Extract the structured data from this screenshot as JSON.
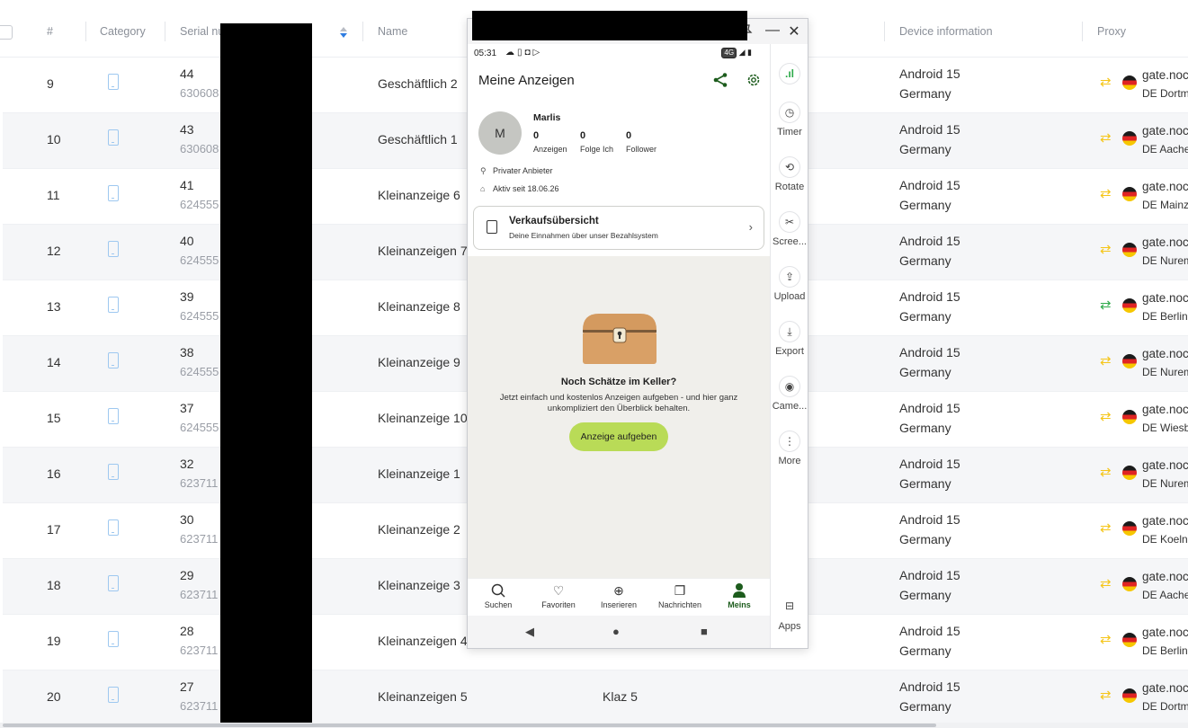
{
  "table": {
    "headers": {
      "idx": "#",
      "category": "Category",
      "serial": "Serial nu",
      "name": "Name",
      "device": "Device information",
      "proxy": "Proxy"
    },
    "rows": [
      {
        "idx": "9",
        "serial": "44",
        "serial2": "630608",
        "name": "Geschäftlich 2",
        "note": "",
        "os": "Android 15",
        "country": "Germany",
        "gate": "gate.noc",
        "loc": "DE Dortm",
        "swap_color": "#f5c518"
      },
      {
        "idx": "10",
        "serial": "43",
        "serial2": "630608",
        "name": "Geschäftlich 1",
        "note": "",
        "os": "Android 15",
        "country": "Germany",
        "gate": "gate.noc",
        "loc": "DE Aache",
        "swap_color": "#f5c518"
      },
      {
        "idx": "11",
        "serial": "41",
        "serial2": "624555",
        "name": "Kleinanzeige 6",
        "note": "",
        "os": "Android 15",
        "country": "Germany",
        "gate": "gate.noc",
        "loc": "DE Mainz",
        "swap_color": "#f5c518"
      },
      {
        "idx": "12",
        "serial": "40",
        "serial2": "624555",
        "name": "Kleinanzeigen 7",
        "note": "",
        "os": "Android 15",
        "country": "Germany",
        "gate": "gate.noc",
        "loc": "DE Nurem",
        "swap_color": "#f5c518"
      },
      {
        "idx": "13",
        "serial": "39",
        "serial2": "624555",
        "name": "Kleinanzeige 8",
        "note": "",
        "os": "Android 15",
        "country": "Germany",
        "gate": "gate.noc",
        "loc": "DE Berlin",
        "swap_color": "#2eaa4a"
      },
      {
        "idx": "14",
        "serial": "38",
        "serial2": "624555",
        "name": "Kleinanzeige 9",
        "note": "",
        "os": "Android 15",
        "country": "Germany",
        "gate": "gate.noc",
        "loc": "DE Nurem",
        "swap_color": "#f5c518"
      },
      {
        "idx": "15",
        "serial": "37",
        "serial2": "624555",
        "name": "Kleinanzeige 10",
        "note": "",
        "os": "Android 15",
        "country": "Germany",
        "gate": "gate.noc",
        "loc": "DE Wiesb",
        "swap_color": "#f5c518"
      },
      {
        "idx": "16",
        "serial": "32",
        "serial2": "623711",
        "name": "Kleinanzeige 1",
        "note": "",
        "os": "Android 15",
        "country": "Germany",
        "gate": "gate.noc",
        "loc": "DE Nurem",
        "swap_color": "#f5c518"
      },
      {
        "idx": "17",
        "serial": "30",
        "serial2": "623711",
        "name": "Kleinanzeige 2",
        "note": "",
        "os": "Android 15",
        "country": "Germany",
        "gate": "gate.noc",
        "loc": "DE Koeln",
        "swap_color": "#f5c518"
      },
      {
        "idx": "18",
        "serial": "29",
        "serial2": "623711",
        "name": "Kleinanzeige 3",
        "note": "",
        "os": "Android 15",
        "country": "Germany",
        "gate": "gate.noc",
        "loc": "DE Aache",
        "swap_color": "#f5c518"
      },
      {
        "idx": "19",
        "serial": "28",
        "serial2": "623711",
        "name": "Kleinanzeigen 4",
        "note": "",
        "os": "Android 15",
        "country": "Germany",
        "gate": "gate.noc",
        "loc": "DE Berlin",
        "swap_color": "#f5c518"
      },
      {
        "idx": "20",
        "serial": "27",
        "serial2": "623711",
        "name": "Kleinanzeigen 5",
        "note": "Klaz 5",
        "os": "Android 15",
        "country": "Germany",
        "gate": "gate.noc",
        "loc": "DE Dortm",
        "swap_color": "#f5c518"
      }
    ]
  },
  "phone": {
    "window_buttons": {
      "pin": "pin-icon",
      "minimize": "—",
      "close": "✕"
    },
    "status_bar": {
      "time": "05:31",
      "network": "4G"
    },
    "app_title": "Meine Anzeigen",
    "profile": {
      "avatar_letter": "M",
      "name": "Marlis",
      "stats": [
        {
          "value": "0",
          "label": "Anzeigen"
        },
        {
          "value": "0",
          "label": "Folge Ich"
        },
        {
          "value": "0",
          "label": "Follower"
        }
      ],
      "seller_type": "Privater Anbieter",
      "active_since": "Aktiv seit 18.06.26"
    },
    "sales_card": {
      "title": "Verkaufsübersicht",
      "subtitle": "Deine Einnahmen über unser Bezahlsystem"
    },
    "empty_state": {
      "title": "Noch Schätze im Keller?",
      "text": "Jetzt einfach und kostenlos Anzeigen aufgeben - und hier ganz unkompliziert den Überblick behalten.",
      "cta": "Anzeige aufgeben"
    },
    "bottom_nav": [
      {
        "label": "Suchen",
        "icon": "search-icon"
      },
      {
        "label": "Favoriten",
        "icon": "heart-icon"
      },
      {
        "label": "Inserieren",
        "icon": "add-ad-icon"
      },
      {
        "label": "Nachrichten",
        "icon": "messages-icon"
      },
      {
        "label": "Meins",
        "icon": "person-icon"
      }
    ],
    "side_toolbar": [
      {
        "label": "",
        "icon": "signal-icon"
      },
      {
        "label": "Timer",
        "icon": "timer-icon"
      },
      {
        "label": "Rotate",
        "icon": "rotate-icon"
      },
      {
        "label": "Scree...",
        "icon": "screenshot-icon"
      },
      {
        "label": "Upload",
        "icon": "upload-icon"
      },
      {
        "label": "Export",
        "icon": "export-icon"
      },
      {
        "label": "Came...",
        "icon": "camera-icon"
      },
      {
        "label": "More",
        "icon": "more-icon"
      },
      {
        "label": "Apps",
        "icon": "apps-icon"
      }
    ]
  },
  "colors": {
    "accent_green": "#b9db57",
    "brand_dark_green": "#1d5c1d",
    "signal_green": "#2eaa4a",
    "proxy_swap_yellow": "#f5c518"
  }
}
